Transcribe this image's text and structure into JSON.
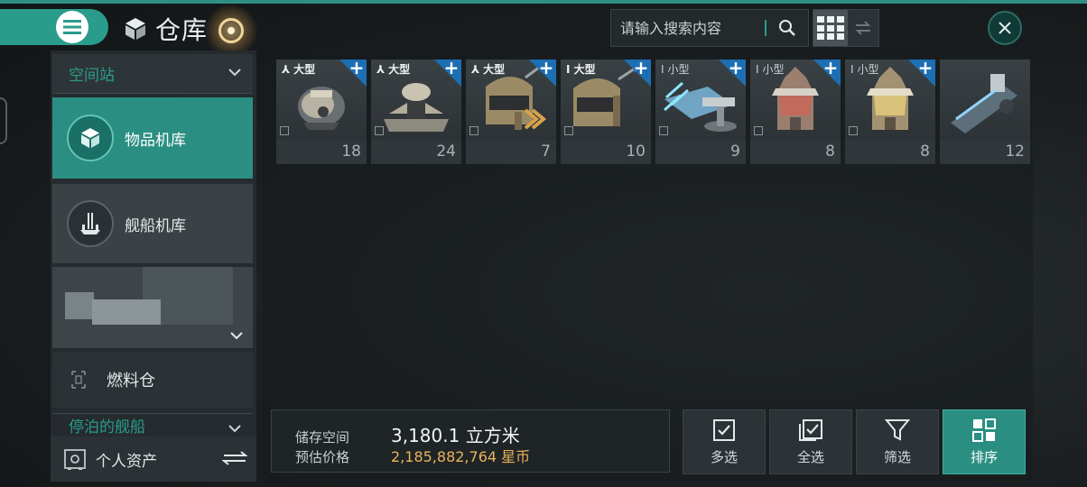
{
  "header": {
    "title": "仓库",
    "search_placeholder": "请输入搜索内容"
  },
  "sidebar": {
    "section_station": "空间站",
    "items": [
      {
        "label": "物品机库",
        "active": true
      },
      {
        "label": "舰船机库",
        "active": false
      }
    ],
    "fuel_label": "燃料仓",
    "docked_label": "停泊的舰船",
    "personal_assets": "个人资产"
  },
  "items": [
    {
      "size": "大型",
      "count": "18",
      "icon": "armor-plate-module"
    },
    {
      "size": "大型",
      "count": "24",
      "icon": "turret-mount-module"
    },
    {
      "size": "大型",
      "count": "7",
      "icon": "welding-mask-module"
    },
    {
      "size": "大型",
      "count": "10",
      "icon": "welding-mask-module"
    },
    {
      "size": "小型",
      "count": "9",
      "icon": "plasma-cannon-module"
    },
    {
      "size": "小型",
      "count": "8",
      "icon": "helmet-red-module"
    },
    {
      "size": "小型",
      "count": "8",
      "icon": "helmet-gold-module"
    },
    {
      "size": "",
      "count": "12",
      "icon": "rail-launcher-module"
    }
  ],
  "storage": {
    "space_label": "储存空间",
    "space_value": "3,180.1 立方米",
    "price_label": "预估价格",
    "price_value": "2,185,882,764 星币"
  },
  "actions": {
    "multi": "多选",
    "all": "全选",
    "filter": "筛选",
    "sort": "排序"
  },
  "colors": {
    "accent": "#2a9c8c",
    "price": "#e8b45a",
    "corner_blue": "#1d6fb3"
  }
}
